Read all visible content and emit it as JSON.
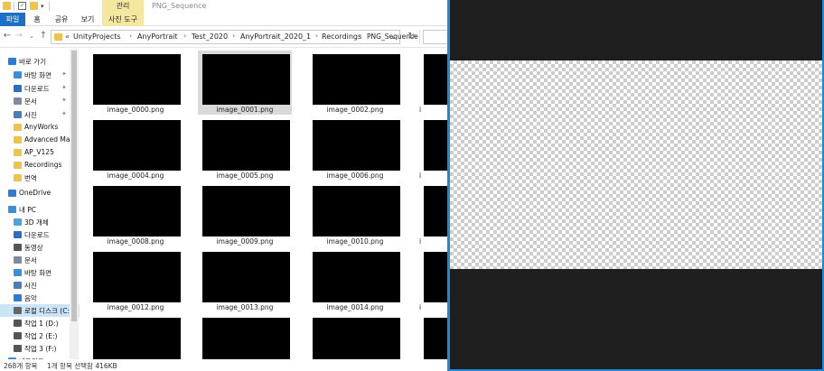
{
  "window": {
    "context_tab": "관리",
    "title": "PNG_Sequence"
  },
  "ribbon": {
    "tabs": [
      "파일",
      "홈",
      "공유",
      "보기",
      "사진 도구"
    ]
  },
  "address": {
    "crumbs": [
      "UnityProjects",
      "AnyPortrait",
      "Test_2020",
      "AnyPortrait_2020_1",
      "Recordings",
      "PNG_Sequence"
    ]
  },
  "nav": {
    "quick_access": "바로 가기",
    "items": [
      {
        "label": "바로 가기",
        "icon": "star-icon",
        "color": "#2b7cd3",
        "indent": 0
      },
      {
        "label": "바탕 화면",
        "icon": "desktop-icon",
        "color": "#3a8fd8",
        "indent": 1,
        "pinned": true
      },
      {
        "label": "다운로드",
        "icon": "download-icon",
        "color": "#2b6fc4",
        "indent": 1,
        "pinned": true
      },
      {
        "label": "문서",
        "icon": "document-icon",
        "color": "#7a8ca0",
        "indent": 1,
        "pinned": true
      },
      {
        "label": "사진",
        "icon": "pictures-icon",
        "color": "#4a7fb5",
        "indent": 1,
        "pinned": true
      },
      {
        "label": "AnyWorks",
        "icon": "folder-icon",
        "color": "#f0c24a",
        "indent": 1
      },
      {
        "label": "Advanced Manu",
        "icon": "folder-icon",
        "color": "#f0c24a",
        "indent": 1
      },
      {
        "label": "AP_V125",
        "icon": "folder-icon",
        "color": "#f0c24a",
        "indent": 1
      },
      {
        "label": "Recordings",
        "icon": "folder-icon",
        "color": "#f0c24a",
        "indent": 1
      },
      {
        "label": "번역",
        "icon": "folder-icon",
        "color": "#f0c24a",
        "indent": 1
      },
      {
        "label": "OneDrive",
        "icon": "cloud-icon",
        "color": "#2b7cd3",
        "indent": 0
      },
      {
        "label": "내 PC",
        "icon": "pc-icon",
        "color": "#3a8fd8",
        "indent": 0
      },
      {
        "label": "3D 개체",
        "icon": "3d-objects-icon",
        "color": "#49a6d8",
        "indent": 1
      },
      {
        "label": "다운로드",
        "icon": "download-icon",
        "color": "#2b6fc4",
        "indent": 1
      },
      {
        "label": "동영상",
        "icon": "video-icon",
        "color": "#555555",
        "indent": 1
      },
      {
        "label": "문서",
        "icon": "document-icon",
        "color": "#7a8ca0",
        "indent": 1
      },
      {
        "label": "바탕 화면",
        "icon": "desktop-icon",
        "color": "#3a8fd8",
        "indent": 1
      },
      {
        "label": "사진",
        "icon": "pictures-icon",
        "color": "#4a7fb5",
        "indent": 1
      },
      {
        "label": "음악",
        "icon": "music-icon",
        "color": "#2b7cd3",
        "indent": 1
      },
      {
        "label": "로컬 디스크 (C:)",
        "icon": "drive-icon",
        "color": "#666666",
        "indent": 1,
        "selected": true
      },
      {
        "label": "작업 1 (D:)",
        "icon": "drive-icon",
        "color": "#555555",
        "indent": 1
      },
      {
        "label": "작업 2 (E:)",
        "icon": "drive-icon",
        "color": "#555555",
        "indent": 1
      },
      {
        "label": "작업 3 (F:)",
        "icon": "drive-icon",
        "color": "#555555",
        "indent": 1
      },
      {
        "label": "네트워크",
        "icon": "network-icon",
        "color": "#3a8fd8",
        "indent": 0
      }
    ]
  },
  "files": [
    {
      "name": "image_0000.png"
    },
    {
      "name": "image_0001.png",
      "selected": true
    },
    {
      "name": "image_0002.png"
    },
    {
      "name": "i"
    },
    {
      "name": ""
    },
    {
      "name": "image_0005.png"
    },
    {
      "name": "image_0006.png"
    },
    {
      "name": "i"
    },
    {
      "name": "image_0008.png"
    },
    {
      "name": "image_0009.png"
    },
    {
      "name": "image_0010.png"
    },
    {
      "name": "i"
    },
    {
      "name": "image_0012.png"
    },
    {
      "name": "image_0013.png"
    },
    {
      "name": "image_0014.png"
    },
    {
      "name": "i"
    },
    {
      "name": ""
    },
    {
      "name": ""
    },
    {
      "name": ""
    },
    {
      "name": ""
    }
  ],
  "row2_first": "image_0004.png",
  "status": {
    "count": "268개 항목",
    "selection": "1개 항목 선택함 416KB"
  },
  "colors": {
    "accent": "#1b8ad8",
    "file_tab": "#1b6fc4",
    "context_tab": "#f6e7a0",
    "preview_bg": "#1e1e1e"
  }
}
